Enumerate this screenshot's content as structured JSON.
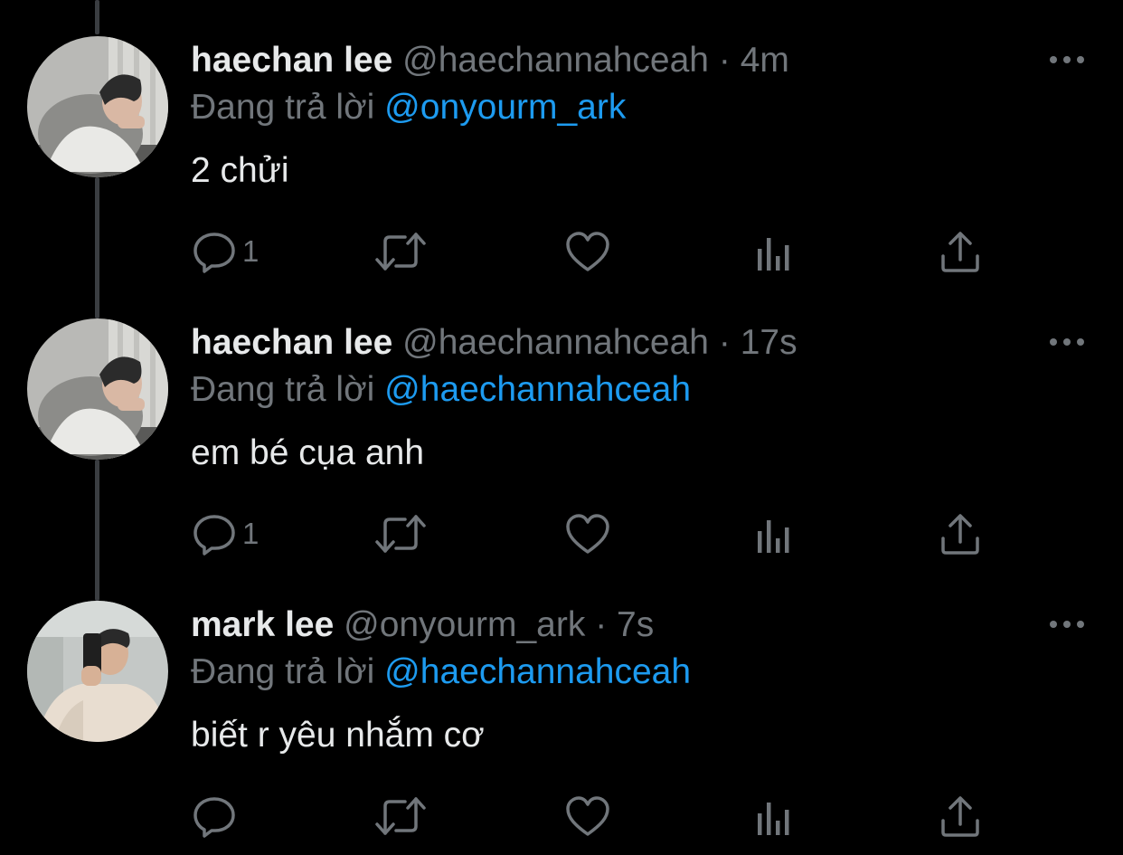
{
  "tweets": [
    {
      "name": "haechan lee",
      "handle": "@haechannahceah",
      "separator": "·",
      "time": "4m",
      "reply_prefix": "Đang trả lời",
      "reply_to": "@onyourm_ark",
      "text": "2 chửi",
      "reply_count": "1",
      "avatar": "haechan-avatar"
    },
    {
      "name": "haechan lee",
      "handle": "@haechannahceah",
      "separator": "·",
      "time": "17s",
      "reply_prefix": "Đang trả lời",
      "reply_to": "@haechannahceah",
      "text": "em bé cụa anh",
      "reply_count": "1",
      "avatar": "haechan-avatar"
    },
    {
      "name": "mark lee",
      "handle": "@onyourm_ark",
      "separator": "·",
      "time": "7s",
      "reply_prefix": "Đang trả lời",
      "reply_to": "@haechannahceah",
      "text": "biết r yêu nhắm cơ",
      "reply_count": "",
      "avatar": "mark-avatar"
    }
  ],
  "icons": {
    "reply": "comment-bubble-icon",
    "retweet": "retweet-icon",
    "like": "heart-icon",
    "analytics": "analytics-bars-icon",
    "share": "share-upload-icon",
    "more": "more-dots-icon"
  },
  "colors": {
    "background": "#000000",
    "text": "#e7e9ea",
    "secondary": "#71767b",
    "link": "#1d9bf0",
    "thread_line": "#3a3d41"
  }
}
